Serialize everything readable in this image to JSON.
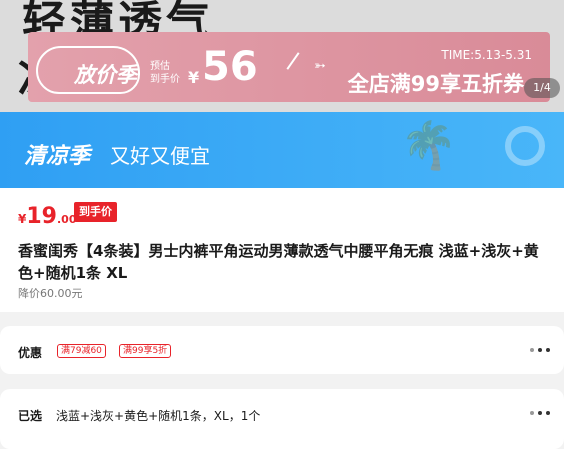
{
  "hero": {
    "big_text_line1": "轻薄透气",
    "big_text_line2": "冰",
    "image_counter": "1/4"
  },
  "promo": {
    "brand": "放价季",
    "estimate_label_1": "预估",
    "estimate_label_2": "到手价",
    "currency": "¥",
    "price": "56",
    "time": "TIME:5.13-5.31",
    "offer": "全店满99享五折券"
  },
  "banner": {
    "title": "清凉季",
    "tagline": "又好又便宜"
  },
  "product": {
    "currency": "¥",
    "price_int": "19",
    "price_dec": ".00",
    "price_tag": "到手价",
    "title": "香蜜闺秀【4条装】男士内裤平角运动男薄款透气中腰平角无痕 浅蓝+浅灰+黄色+随机1条 XL",
    "original_price": "降价60.00元"
  },
  "discount": {
    "label": "优惠",
    "chips": [
      "满79减60",
      "满99享5折"
    ]
  },
  "selected": {
    "label": "已选",
    "value": "浅蓝+浅灰+黄色+随机1条，XL，1个"
  },
  "colors": {
    "accent_red": "#e8232a",
    "banner_blue": "#3aa8f6",
    "promo_pink": "#df97a3"
  }
}
